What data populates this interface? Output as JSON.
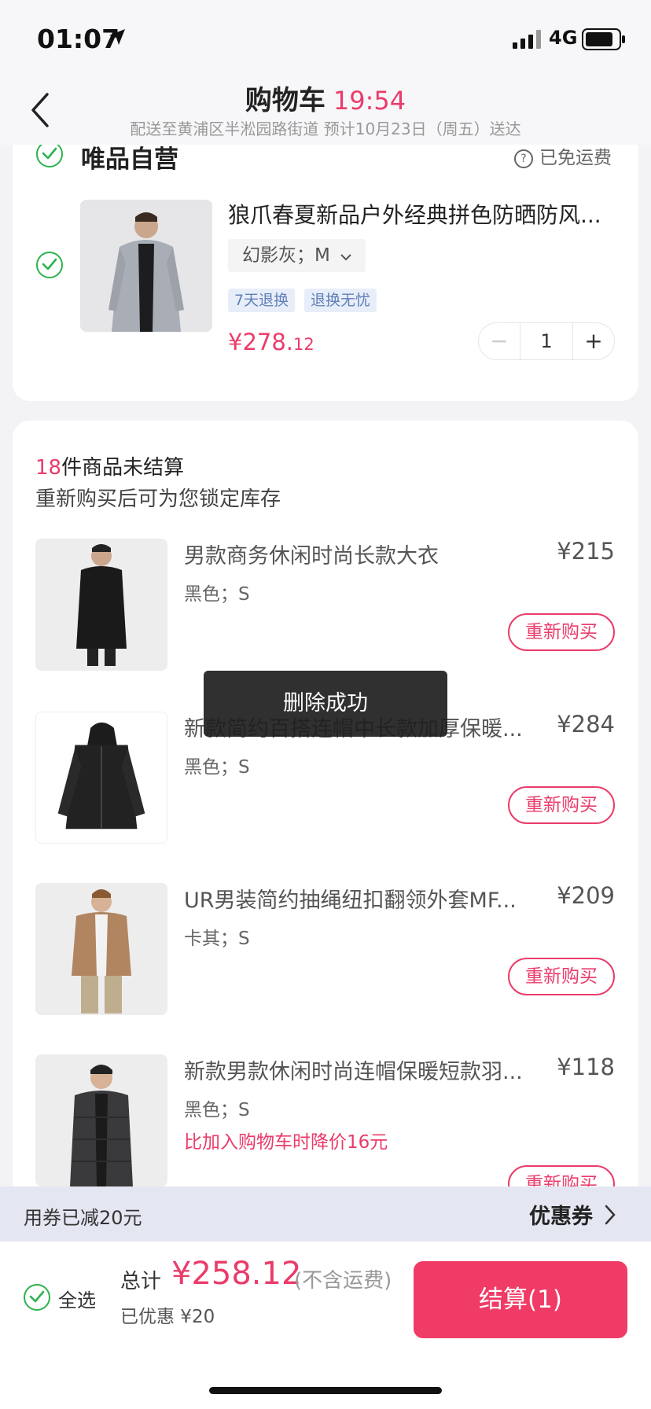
{
  "status": {
    "time": "01:07",
    "network": "4G"
  },
  "header": {
    "title": "购物车",
    "timer": "19:54",
    "delivery": "配送至黄浦区半淞园路街道   预计10月23日（周五）送达"
  },
  "store": {
    "name": "唯品自营",
    "shipping_icon": "?",
    "shipping": "已免运费"
  },
  "cart_item": {
    "title": "狼爪春夏新品户外经典拼色防晒防风...",
    "variant": "幻影灰；M",
    "tags": [
      "7天退换",
      "退换无忧"
    ],
    "price_main": "¥278.",
    "price_cents": "12",
    "qty_minus": "−",
    "quantity": "1",
    "qty_plus": "+"
  },
  "unsettled": {
    "count": "18",
    "count_suffix": "件商品未结算",
    "subtitle": "重新购买后可为您锁定库存",
    "rebuy_label": "重新购买",
    "items": [
      {
        "title": "男款商务休闲时尚长款大衣",
        "price": "¥215",
        "variant": "黑色；S",
        "note": ""
      },
      {
        "title": "新款简约百搭连帽中长款加厚保暖...",
        "price": "¥284",
        "variant": "黑色；S",
        "note": ""
      },
      {
        "title": "UR男装简约抽绳纽扣翻领外套MF...",
        "price": "¥209",
        "variant": "卡其；S",
        "note": ""
      },
      {
        "title": "新款男款休闲时尚连帽保暖短款羽...",
        "price": "¥118",
        "variant": "黑色；S",
        "note": "比加入购物车时降价16元"
      }
    ]
  },
  "toast": "删除成功",
  "coupon": {
    "applied": "用券已减20元",
    "link": "优惠券"
  },
  "footer": {
    "select_all": "全选",
    "total_label": "总计",
    "total": "¥258.12",
    "total_note": "(不含运费)",
    "saved": "已优惠 ¥20",
    "checkout": "结算(1)"
  },
  "colors": {
    "accent": "#ef3b66",
    "check": "#2bb24c",
    "tag_bg": "#e8eef9"
  }
}
